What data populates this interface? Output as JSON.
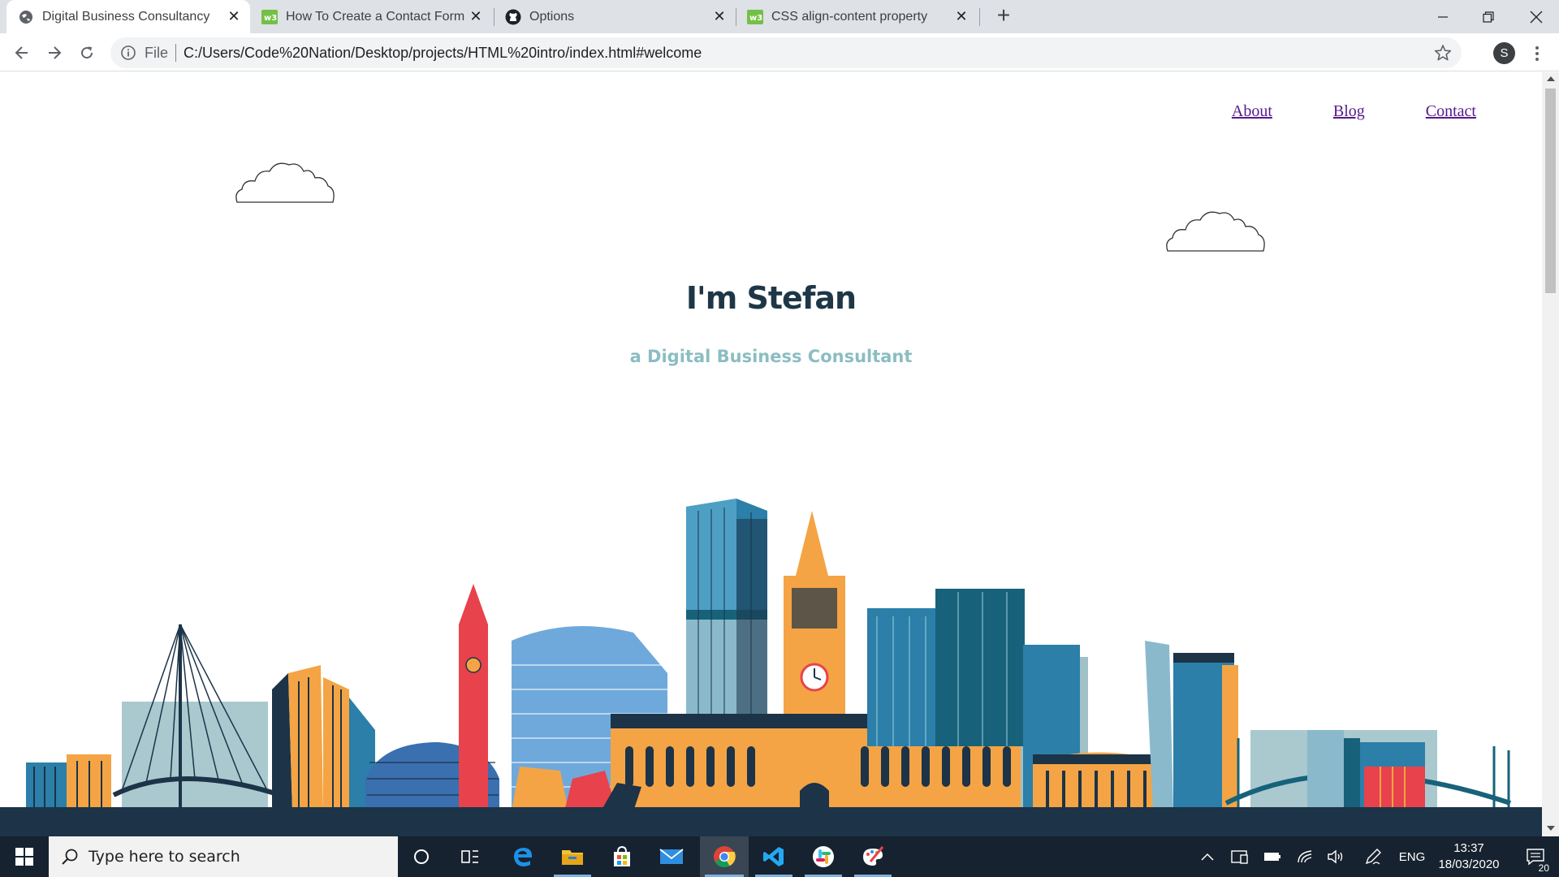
{
  "browser": {
    "tabs": [
      {
        "title": "Digital Business Consultancy",
        "icon": "globe-icon",
        "active": true
      },
      {
        "title": "How To Create a Contact Form w",
        "icon": "w3schools-icon",
        "active": false
      },
      {
        "title": "Options",
        "icon": "github-icon",
        "active": false
      },
      {
        "title": "CSS align-content property",
        "icon": "w3schools-icon",
        "active": false
      }
    ],
    "omnibox": {
      "scheme_label": "File",
      "url": "C:/Users/Code%20Nation/Desktop/projects/HTML%20intro/index.html#welcome"
    },
    "profile_initial": "S"
  },
  "page": {
    "nav": {
      "about": "About",
      "blog": "Blog",
      "contact": "Contact"
    },
    "hero_title": "I'm Stefan",
    "hero_subtitle": "a Digital Business Consultant"
  },
  "colors": {
    "title": "#1e3747",
    "subtitle": "#8bbdc2",
    "link": "#551a8b",
    "skyline_navy": "#1c3348",
    "skyline_orange": "#f4a444",
    "skyline_blue": "#2b7fa8",
    "skyline_red": "#e8424c",
    "taskbar": "#16222f"
  },
  "taskbar": {
    "search_placeholder": "Type here to search",
    "apps": [
      "cortana-icon",
      "task-view-icon",
      "edge-icon",
      "file-explorer-icon",
      "store-icon",
      "mail-icon",
      "chrome-icon",
      "vscode-icon",
      "slack-icon",
      "paint-icon"
    ],
    "language": "ENG",
    "time": "13:37",
    "date": "18/03/2020",
    "notification_count": "20"
  }
}
